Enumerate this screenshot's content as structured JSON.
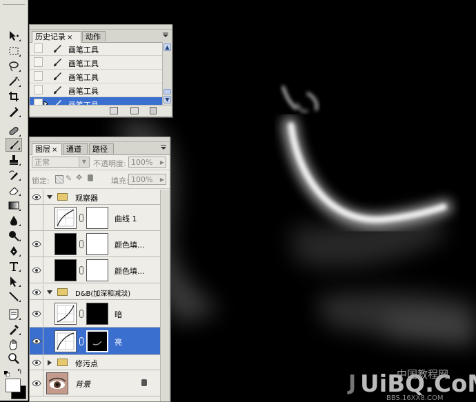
{
  "history_panel": {
    "tabs": [
      {
        "label": "历史记录",
        "active": true
      },
      {
        "label": "动作",
        "active": false
      }
    ],
    "close_glyph": "×",
    "items": [
      {
        "label": "画笔工具",
        "selected": false
      },
      {
        "label": "画笔工具",
        "selected": false
      },
      {
        "label": "画笔工具",
        "selected": false
      },
      {
        "label": "画笔工具",
        "selected": false
      },
      {
        "label": "画笔工具",
        "selected": true
      }
    ]
  },
  "layers_panel": {
    "tabs": [
      {
        "label": "图层",
        "active": true
      },
      {
        "label": "通道",
        "active": false
      },
      {
        "label": "路径",
        "active": false
      }
    ],
    "close_glyph": "×",
    "blend_mode": "正常",
    "opacity_label": "不透明度:",
    "opacity_value": "100%",
    "lock_label": "锁定:",
    "fill_label": "填充:",
    "fill_value": "100%",
    "layers": [
      {
        "name": "观察器",
        "kind": "group",
        "expanded": true,
        "visible": true
      },
      {
        "name": "曲线 1",
        "kind": "curves",
        "visible": false
      },
      {
        "name": "颜色填...",
        "kind": "fill",
        "visible": true
      },
      {
        "name": "颜色填...",
        "kind": "fill",
        "visible": true
      },
      {
        "name": "D&B(加深和减淡)",
        "kind": "group",
        "expanded": true,
        "visible": true
      },
      {
        "name": "暗",
        "kind": "curves",
        "visible": true
      },
      {
        "name": "亮",
        "kind": "curves",
        "visible": true,
        "selected": true
      },
      {
        "name": "修污点",
        "kind": "group",
        "expanded": false,
        "visible": true
      },
      {
        "name": "背景",
        "kind": "background",
        "visible": true,
        "locked": true
      }
    ]
  },
  "colors": {
    "selection": "#3a6fd0",
    "panel_bg": "#eeede7",
    "toolbar_bg": "#e4e3db",
    "canvas_bg": "#000000"
  }
}
